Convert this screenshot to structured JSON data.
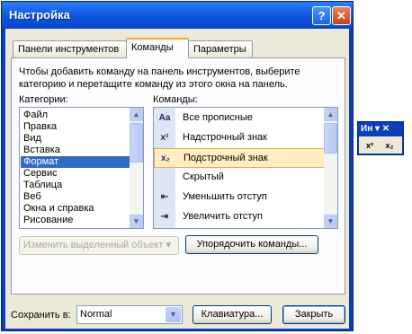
{
  "window": {
    "title": "Настройка",
    "help_label": "?",
    "close_label": "✕"
  },
  "tabs": [
    {
      "label": "Панели инструментов"
    },
    {
      "label": "Команды"
    },
    {
      "label": "Параметры"
    }
  ],
  "commands_tab": {
    "description": "Чтобы добавить команду на панель инструментов, выберите категорию и перетащите команду из этого окна на панель.",
    "categories_label": "Категории:",
    "commands_label": "Команды:",
    "categories": [
      "Файл",
      "Правка",
      "Вид",
      "Вставка",
      "Формат",
      "Сервис",
      "Таблица",
      "Веб",
      "Окна и справка",
      "Рисование"
    ],
    "selected_category": "Формат",
    "commands": [
      {
        "icon": "change-case-icon",
        "glyph": "Aa",
        "label": "Все прописные"
      },
      {
        "icon": "superscript-icon",
        "glyph": "x²",
        "label": "Надстрочный знак"
      },
      {
        "icon": "subscript-icon",
        "glyph": "x₂",
        "label": "Подстрочный знак"
      },
      {
        "icon": "hidden-icon",
        "glyph": "",
        "label": "Скрытый"
      },
      {
        "icon": "decrease-indent-icon",
        "glyph": "⇤",
        "label": "Уменьшить отступ"
      },
      {
        "icon": "increase-indent-icon",
        "glyph": "⇥",
        "label": "Увеличить отступ"
      }
    ],
    "selected_command": "Подстрочный знак",
    "modify_selection_label": "Изменить выделенный объект ▾",
    "rearrange_label": "Упорядочить команды..."
  },
  "footer": {
    "save_in_label": "Сохранить в:",
    "save_in_value": "Normal",
    "keyboard_label": "Клавиатура...",
    "close_label": "Закрыть"
  },
  "floating_toolbar": {
    "title": "Ин ▾ ✕",
    "buttons": [
      {
        "icon": "superscript-icon",
        "glyph": "x²"
      },
      {
        "icon": "subscript-icon",
        "glyph": "x₂"
      }
    ]
  },
  "colors": {
    "title_bar": "#0c55e0",
    "selection": "#316ac5",
    "hover_highlight": "#ffeec2",
    "active_tab_accent": "#f9a334"
  }
}
